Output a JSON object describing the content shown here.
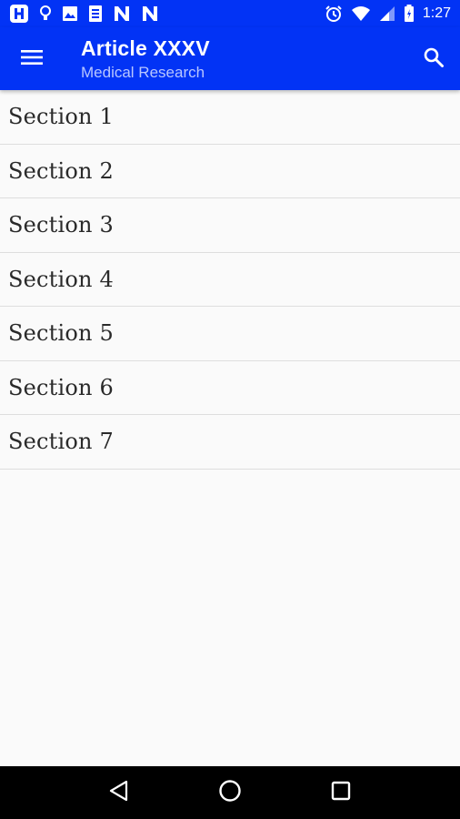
{
  "status_bar": {
    "time": "1:27",
    "left_icons": [
      "app-h-icon",
      "lightbulb-icon",
      "image-icon",
      "document-icon",
      "n-notification-icon",
      "n-notification-icon"
    ],
    "right_icons": [
      "alarm-icon",
      "wifi-icon",
      "signal-icon",
      "battery-icon"
    ]
  },
  "app_bar": {
    "title": "Article XXXV",
    "subtitle": "Medical Research",
    "menu_icon": "menu-icon",
    "search_icon": "search-icon",
    "color": "#0233f5"
  },
  "sections": [
    {
      "label": "Section 1"
    },
    {
      "label": "Section 2"
    },
    {
      "label": "Section 3"
    },
    {
      "label": "Section 4"
    },
    {
      "label": "Section 5"
    },
    {
      "label": "Section 6"
    },
    {
      "label": "Section 7"
    }
  ],
  "nav_bar": {
    "buttons": [
      "back-icon",
      "home-icon",
      "recents-icon"
    ]
  }
}
